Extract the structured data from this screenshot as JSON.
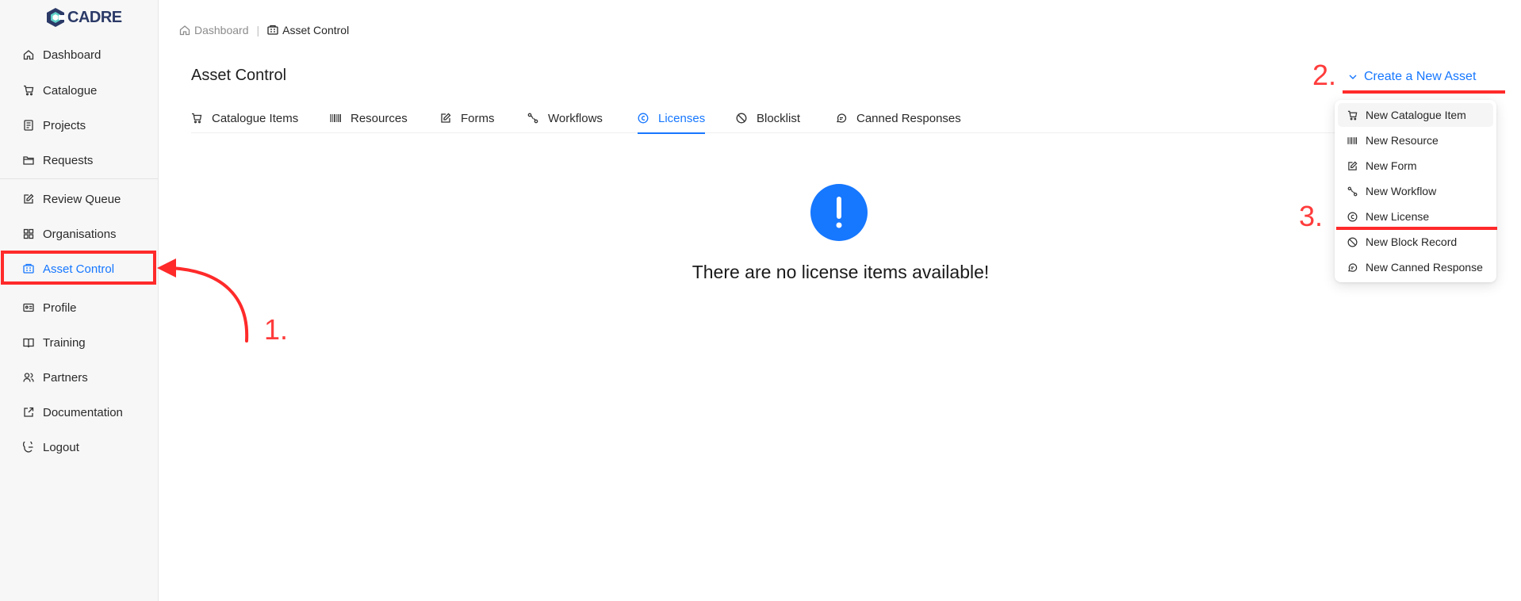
{
  "app": {
    "logo_text": "CADRE"
  },
  "sidebar": {
    "items": [
      {
        "label": "Dashboard",
        "icon": "home-icon"
      },
      {
        "label": "Catalogue",
        "icon": "cart-icon"
      },
      {
        "label": "Projects",
        "icon": "file-icon"
      },
      {
        "label": "Requests",
        "icon": "folder-icon"
      },
      {
        "label": "Review Queue",
        "icon": "edit-icon"
      },
      {
        "label": "Organisations",
        "icon": "grid-icon"
      },
      {
        "label": "Asset Control",
        "icon": "asset-icon",
        "active": true
      },
      {
        "label": "Profile",
        "icon": "id-card-icon"
      },
      {
        "label": "Training",
        "icon": "book-icon"
      },
      {
        "label": "Partners",
        "icon": "users-icon"
      },
      {
        "label": "Documentation",
        "icon": "external-edit-icon"
      },
      {
        "label": "Logout",
        "icon": "logout-icon"
      }
    ]
  },
  "breadcrumb": {
    "home": "Dashboard",
    "separator": "|",
    "current": "Asset Control"
  },
  "page": {
    "title": "Asset Control"
  },
  "tabs": [
    {
      "label": "Catalogue Items",
      "icon": "cart-icon"
    },
    {
      "label": "Resources",
      "icon": "barcode-icon"
    },
    {
      "label": "Forms",
      "icon": "edit-icon"
    },
    {
      "label": "Workflows",
      "icon": "workflow-icon"
    },
    {
      "label": "Licenses",
      "icon": "copyright-icon",
      "active": true
    },
    {
      "label": "Blocklist",
      "icon": "block-icon"
    },
    {
      "label": "Canned Responses",
      "icon": "chat-icon"
    }
  ],
  "empty_state": {
    "icon": "exclamation-icon",
    "text": "There are no license items available!"
  },
  "create": {
    "label": "Create a New Asset",
    "menu": [
      {
        "label": "New Catalogue Item",
        "icon": "cart-icon"
      },
      {
        "label": "New Resource",
        "icon": "barcode-icon"
      },
      {
        "label": "New Form",
        "icon": "edit-icon"
      },
      {
        "label": "New Workflow",
        "icon": "workflow-icon"
      },
      {
        "label": "New License",
        "icon": "copyright-icon"
      },
      {
        "label": "New Block Record",
        "icon": "block-icon"
      },
      {
        "label": "New Canned Response",
        "icon": "chat-icon"
      }
    ]
  },
  "annotations": {
    "step1": "1.",
    "step2": "2.",
    "step3": "3.",
    "color": "#ff2a2a"
  },
  "colors": {
    "accent": "#1677ff",
    "sidebar_bg": "#f7f7f7",
    "annotation": "#ff2a2a"
  }
}
